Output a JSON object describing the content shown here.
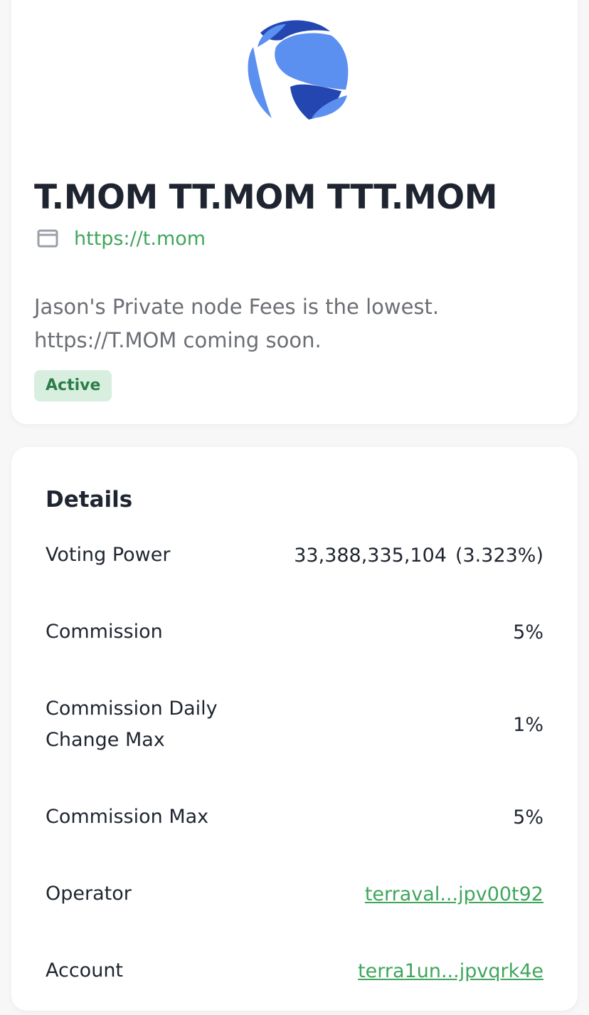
{
  "validator": {
    "name": "T.MOM TT.MOM TTT.MOM",
    "website": "https://t.mom",
    "description": "Jason's Private node Fees is the lowest. https://T.MOM coming soon.",
    "status": "Active",
    "logo_icon": "terra-luna-logo",
    "website_icon": "browser-window-icon"
  },
  "details": {
    "title": "Details",
    "voting_power": {
      "label": "Voting Power",
      "amount": "33,388,335,104",
      "percent": "(3.323%)"
    },
    "commission": {
      "label": "Commission",
      "value": "5%"
    },
    "commission_daily_change_max": {
      "label_line1": "Commission Daily",
      "label_line2": "Change Max",
      "value": "1%"
    },
    "commission_max": {
      "label": "Commission Max",
      "value": "5%"
    },
    "operator": {
      "label": "Operator",
      "value": "terraval...jpv00t92"
    },
    "account": {
      "label": "Account",
      "value": "terra1un...jpvqrk4e"
    }
  },
  "colors": {
    "accent_green": "#3fa65c",
    "badge_bg": "#d8efe0",
    "logo_light_blue": "#5b8ff0",
    "logo_dark_blue": "#2446b0"
  }
}
